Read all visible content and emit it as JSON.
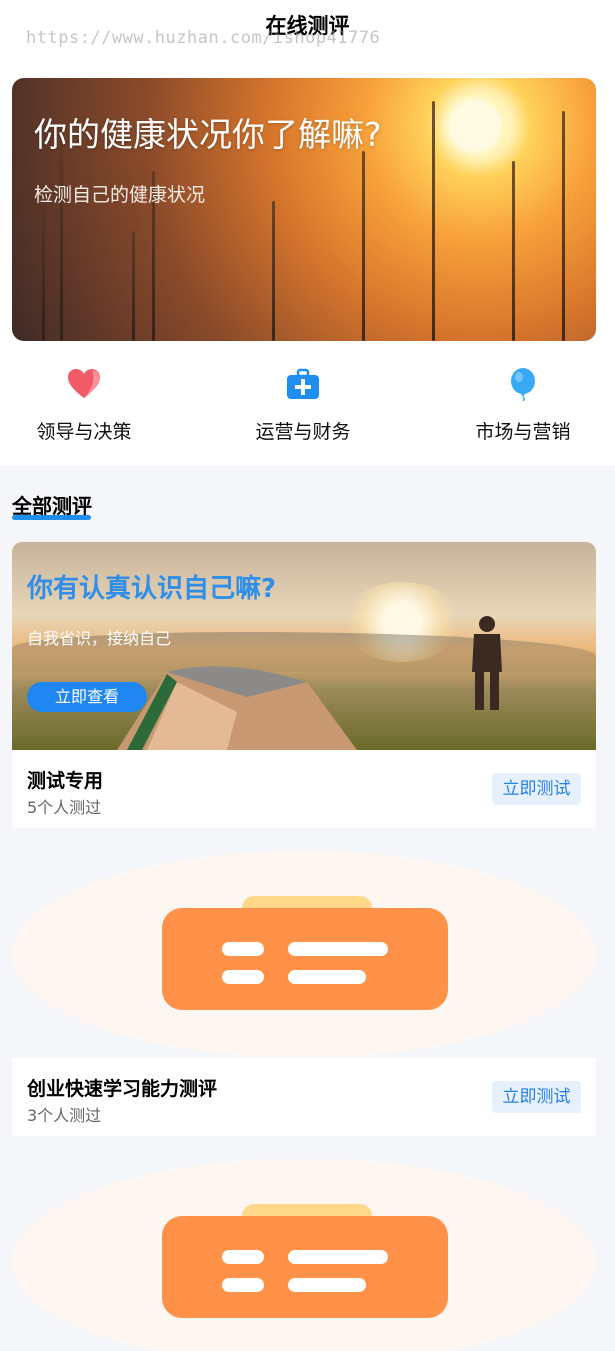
{
  "header": {
    "title": "在线测评",
    "watermark": "https://www.huzhan.com/ishop41776"
  },
  "banner": {
    "title": "你的健康状况你了解嘛?",
    "subtitle": "检测自己的健康状况"
  },
  "categories": [
    {
      "label": "领导与决策",
      "icon": "heart-icon",
      "color": "#f25a68"
    },
    {
      "label": "运营与财务",
      "icon": "first-aid-kit-icon",
      "color": "#1e8ff0"
    },
    {
      "label": "市场与营销",
      "icon": "balloon-icon",
      "color": "#38a9f5"
    }
  ],
  "section": {
    "title": "全部测评",
    "accent": "#1e8ff0"
  },
  "promo": {
    "title": "你有认真认识自己嘛?",
    "subtitle": "自我省识，接纳自己",
    "button": "立即查看"
  },
  "tests": [
    {
      "title": "测试专用",
      "count": "5个人测过",
      "button": "立即测试"
    },
    {
      "title": "创业快速学习能力测评",
      "count": "3个人测过",
      "button": "立即测试"
    }
  ],
  "colors": {
    "accent": "#1e8ff0",
    "button_bg": "#e6f1fd",
    "button_text": "#2680e8",
    "cover_icon": "#ff9248",
    "cover_icon_top": "#ffd88a"
  }
}
